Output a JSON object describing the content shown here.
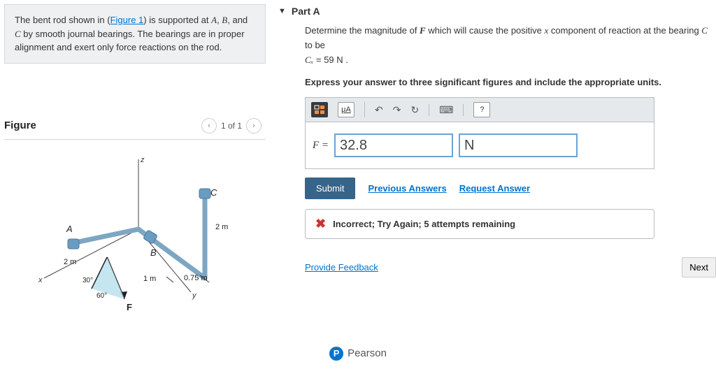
{
  "problem": {
    "text_prefix": "The bent rod shown in (",
    "figure_link": "Figure 1",
    "text_mid": ") is supported at ",
    "var_a": "A",
    "sep1": ", ",
    "var_b": "B",
    "sep2": ", and ",
    "var_c": "C",
    "text_suffix": " by smooth journal bearings. The bearings are in proper alignment and exert only force reactions on the rod."
  },
  "figure": {
    "title": "Figure",
    "counter": "1 of 1",
    "labels": {
      "z": "z",
      "x": "x",
      "y": "y",
      "A": "A",
      "B": "B",
      "C": "C",
      "F": "F",
      "dim2m_a": "2 m",
      "dim2m_b": "2 m",
      "dim1m": "1 m",
      "dim075m": "0.75 m",
      "ang30": "30°",
      "ang60": "60°"
    }
  },
  "part": {
    "title": "Part A",
    "question_p1": "Determine the magnitude of ",
    "var_F": "F",
    "question_p2": " which will cause the positive ",
    "var_x": "x",
    "question_p3": " component of reaction at the bearing ",
    "var_C": "C",
    "question_p4": " to be ",
    "eq_lhs": "Cₓ",
    "eq_mid": " = 59  N",
    "eq_end": " .",
    "instructions": "Express your answer to three significant figures and include the appropriate units."
  },
  "toolbar": {
    "templates": "⬚⬚",
    "unit": "μA",
    "undo": "↶",
    "redo": "↷",
    "reset": "↻",
    "keyboard": "⌨",
    "help": "?"
  },
  "answer": {
    "prefix": "F = ",
    "value": "32.8",
    "unit": "N"
  },
  "actions": {
    "submit": "Submit",
    "previous": "Previous Answers",
    "request": "Request Answer"
  },
  "feedback": {
    "text": "Incorrect; Try Again; 5 attempts remaining"
  },
  "bottom": {
    "provide_feedback": "Provide Feedback",
    "next": "Next"
  },
  "footer": {
    "icon_letter": "P",
    "brand": "Pearson"
  }
}
